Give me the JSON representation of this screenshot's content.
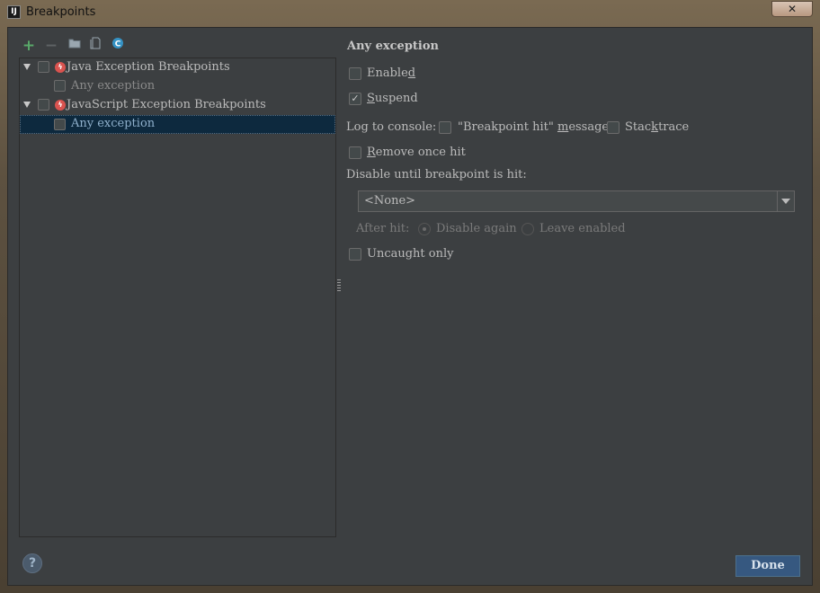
{
  "window": {
    "title": "Breakpoints",
    "app_icon_text": "IJ",
    "close_glyph": "✕"
  },
  "toolbar": {
    "add_icon": "plus-icon",
    "add_glyph": "+",
    "remove_icon": "minus-icon",
    "remove_glyph": "−",
    "group_by_package_icon": "folder-icon",
    "group_by_file_icon": "file-group-icon",
    "group_by_class_icon": "class-icon"
  },
  "tree": {
    "items": [
      {
        "label": "Java Exception Breakpoints",
        "expanded": true,
        "checked": false
      },
      {
        "label": "Any exception",
        "checked": false,
        "disabled": true
      },
      {
        "label": "JavaScript Exception Breakpoints",
        "expanded": true,
        "checked": false
      },
      {
        "label": "Any exception",
        "checked": false,
        "selected": true
      }
    ]
  },
  "details": {
    "title": "Any exception",
    "enabled": {
      "label_pre": "Enable",
      "label_u": "d",
      "label_post": "",
      "checked": false
    },
    "suspend": {
      "label_pre": "",
      "label_u": "S",
      "label_post": "uspend",
      "checked": true,
      "glyph": "✓"
    },
    "log_to_console_label": "Log to console:",
    "log_message": {
      "label_pre": "\"Breakpoint hit\" ",
      "label_u": "m",
      "label_post": "essage",
      "checked": false
    },
    "stacktrace": {
      "label_pre": "Stac",
      "label_u": "k",
      "label_post": "trace",
      "checked": false
    },
    "remove_once_hit": {
      "label_pre": "",
      "label_u": "R",
      "label_post": "emove once hit",
      "checked": false
    },
    "disable_until_label": "Disable until breakpoint is hit:",
    "disable_until_value": "<None>",
    "after_hit_label": "After hit:",
    "disable_again_label": "Disable again",
    "leave_enabled_label": "Leave enabled",
    "after_hit_selected": "Disable again",
    "uncaught_only": {
      "label": "Uncaught only",
      "checked": false
    }
  },
  "footer": {
    "help_glyph": "?",
    "done_label": "Done"
  },
  "colors": {
    "background": "#3c3f41",
    "selection": "#0d293e",
    "accent_button": "#365880",
    "add_green": "#59a869",
    "breakpoint_red": "#d9534f"
  }
}
